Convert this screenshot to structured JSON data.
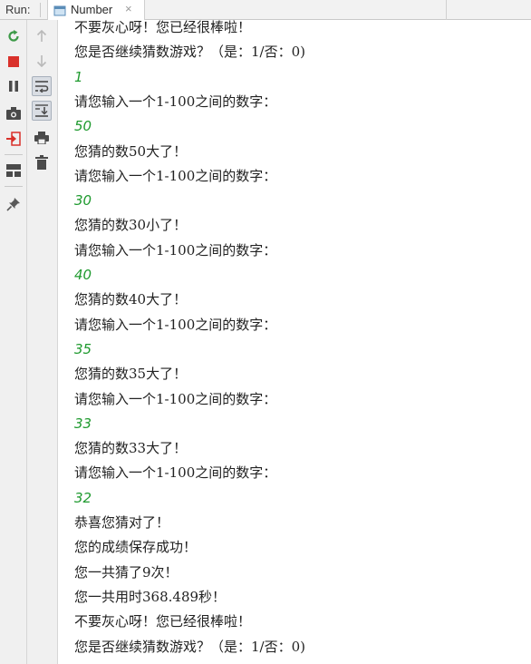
{
  "header": {
    "run_label": "Run:",
    "tab_label": "Number",
    "close_glyph": "×"
  },
  "toolbar": {
    "left_icons": [
      "rerun-icon",
      "stop-icon",
      "pause-icon",
      "camera-icon",
      "login-icon",
      "layout-icon",
      "pin-icon"
    ],
    "right_icons": [
      "up-arrow-icon",
      "down-arrow-icon",
      "soft-wrap-icon",
      "scroll-to-end-icon",
      "print-icon",
      "trash-icon"
    ]
  },
  "console": {
    "lines": [
      {
        "text": "不要灰心呀！您已经很棒啦！",
        "type": "output"
      },
      {
        "text": "您是否继续猜数游戏？（是：1/否：0)",
        "type": "output"
      },
      {
        "text": "1",
        "type": "input"
      },
      {
        "text": "请您输入一个1-100之间的数字：",
        "type": "output"
      },
      {
        "text": "50",
        "type": "input"
      },
      {
        "text": "您猜的数50大了！",
        "type": "output"
      },
      {
        "text": "请您输入一个1-100之间的数字：",
        "type": "output"
      },
      {
        "text": "30",
        "type": "input"
      },
      {
        "text": "您猜的数30小了！",
        "type": "output"
      },
      {
        "text": "请您输入一个1-100之间的数字：",
        "type": "output"
      },
      {
        "text": "40",
        "type": "input"
      },
      {
        "text": "您猜的数40大了！",
        "type": "output"
      },
      {
        "text": "请您输入一个1-100之间的数字：",
        "type": "output"
      },
      {
        "text": "35",
        "type": "input"
      },
      {
        "text": "您猜的数35大了！",
        "type": "output"
      },
      {
        "text": "请您输入一个1-100之间的数字：",
        "type": "output"
      },
      {
        "text": "33",
        "type": "input"
      },
      {
        "text": "您猜的数33大了！",
        "type": "output"
      },
      {
        "text": "请您输入一个1-100之间的数字：",
        "type": "output"
      },
      {
        "text": "32",
        "type": "input"
      },
      {
        "text": "恭喜您猜对了！",
        "type": "output"
      },
      {
        "text": "您的成绩保存成功！",
        "type": "output"
      },
      {
        "text": "您一共猜了9次！",
        "type": "output"
      },
      {
        "text": "您一共用时368.489秒！",
        "type": "output"
      },
      {
        "text": "不要灰心呀！您已经很棒啦！",
        "type": "output"
      },
      {
        "text": "您是否继续猜数游戏？（是：1/否：0)",
        "type": "output"
      }
    ]
  },
  "colors": {
    "input_text": "#1f9a2f",
    "output_text": "#222222",
    "stop_red": "#d9312b",
    "rerun_green": "#3d9a48"
  }
}
